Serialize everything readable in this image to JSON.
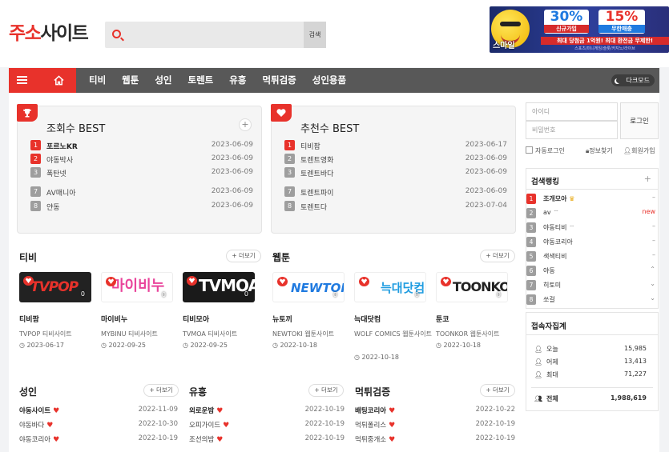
{
  "header": {
    "logo_part1": "주소",
    "logo_part2": "사이트",
    "search_placeholder": "",
    "search_button": "검색",
    "banner": {
      "brand": "스마일",
      "promo1_value": "30%",
      "promo1_label": "신규가입",
      "promo2_value": "15%",
      "promo2_label": "무한매충",
      "headline": "최대 당첨금 1억원! 최대 환전금 무제한!",
      "fineprint": "스포츠/미니게임/슬롯/카지노/라이브"
    }
  },
  "nav": {
    "items": [
      "티비",
      "웹툰",
      "성인",
      "토렌트",
      "유흥",
      "먹튀검증",
      "성인용품"
    ],
    "dark_mode": "다크모드"
  },
  "views_best": {
    "title": "조회수 BEST",
    "rows": [
      {
        "rank": "1",
        "name": "포르노KR",
        "date": "2023-06-09"
      },
      {
        "rank": "2",
        "name": "야동박사",
        "date": "2023-06-09"
      },
      {
        "rank": "3",
        "name": "폭탄넷",
        "date": "2023-06-09"
      },
      {
        "rank": "7",
        "name": "AV매니아",
        "date": "2023-06-09"
      },
      {
        "rank": "8",
        "name": "얀동",
        "date": "2023-06-09"
      }
    ]
  },
  "recommend_best": {
    "title": "추천수 BEST",
    "rows": [
      {
        "rank": "1",
        "name": "티비팜",
        "date": "2023-06-17"
      },
      {
        "rank": "2",
        "name": "토렌트영화",
        "date": "2023-06-09"
      },
      {
        "rank": "3",
        "name": "토렌트바다",
        "date": "2023-06-09"
      },
      {
        "rank": "7",
        "name": "토렌트파이",
        "date": "2023-06-09"
      },
      {
        "rank": "8",
        "name": "토렌트다",
        "date": "2023-07-04"
      }
    ]
  },
  "tv": {
    "title": "티비",
    "more": "+ 더보기",
    "cards": [
      {
        "logo": "TVPOP",
        "name": "티비팜",
        "sub": "TVPOP 티비사이트",
        "date": "2023-06-17",
        "count": "0"
      },
      {
        "logo": "마이비누",
        "name": "마이비누",
        "sub": "MYBINU 티비사이트",
        "date": "2022-09-25",
        "count": "0"
      },
      {
        "logo": "TVMOA",
        "name": "티비모아",
        "sub": "TVMOA 티비사이트",
        "date": "2022-09-25",
        "count": "0"
      }
    ]
  },
  "webtoon": {
    "title": "웹툰",
    "more": "+ 더보기",
    "cards": [
      {
        "logo": "NEWTOKI",
        "name": "뉴토끼",
        "sub": "NEWTOKI 웹툰사이트",
        "date": "2022-10-18",
        "count": "0"
      },
      {
        "logo": "늑대닷컴",
        "name": "늑대닷컴",
        "sub": "WOLF COMICS 웹툰사이트",
        "date": "2022-10-18",
        "count": "0"
      },
      {
        "logo": "TOONKOR",
        "name": "툰코",
        "sub": "TOONKOR 웹툰사이트",
        "date": "2022-10-18",
        "count": "0"
      }
    ]
  },
  "adult": {
    "title": "성인",
    "more": "+ 더보기",
    "rows": [
      {
        "name": "야동사이트",
        "date": "2022-11-09",
        "bold": true
      },
      {
        "name": "야동바다",
        "date": "2022-10-30",
        "bold": false
      },
      {
        "name": "야동코리아",
        "date": "2022-10-19",
        "bold": false
      }
    ]
  },
  "entertain": {
    "title": "유흥",
    "more": "+ 더보기",
    "rows": [
      {
        "name": "외로운밤",
        "date": "2022-10-19",
        "bold": true
      },
      {
        "name": "오피가이드",
        "date": "2022-10-19",
        "bold": false
      },
      {
        "name": "조선의밤",
        "date": "2022-10-19",
        "bold": false
      }
    ]
  },
  "verify": {
    "title": "먹튀검증",
    "more": "+ 더보기",
    "rows": [
      {
        "name": "배팅코리아",
        "date": "2022-10-22",
        "bold": true
      },
      {
        "name": "먹튀폴리스",
        "date": "2022-10-19",
        "bold": false
      },
      {
        "name": "먹튀중개소",
        "date": "2022-10-19",
        "bold": false
      }
    ]
  },
  "login": {
    "id_placeholder": "아이디",
    "pw_placeholder": "비밀번호",
    "button": "로그인",
    "auto_login": "자동로그인",
    "find_info": "정보찾기",
    "join": "회원가입"
  },
  "ranking": {
    "title": "검색랭킹",
    "rows": [
      {
        "rank": "1",
        "name": "조개모아",
        "status": "–"
      },
      {
        "rank": "2",
        "name": "av",
        "status": "new"
      },
      {
        "rank": "3",
        "name": "야동티비",
        "status": "–"
      },
      {
        "rank": "4",
        "name": "야동코리아",
        "status": "–"
      },
      {
        "rank": "5",
        "name": "색색티비",
        "status": "–"
      },
      {
        "rank": "6",
        "name": "야동",
        "status": "⌃"
      },
      {
        "rank": "7",
        "name": "히토미",
        "status": "⌄"
      },
      {
        "rank": "8",
        "name": "쏘걸",
        "status": "⌄"
      }
    ]
  },
  "stats": {
    "title": "접속자집계",
    "today_label": "오늘",
    "today": "15,985",
    "yesterday_label": "어제",
    "yesterday": "13,413",
    "max_label": "최대",
    "max": "71,227",
    "total_label": "전체",
    "total": "1,988,619"
  },
  "colors": {
    "accent": "#e8322b",
    "nav_bg": "#585858"
  }
}
